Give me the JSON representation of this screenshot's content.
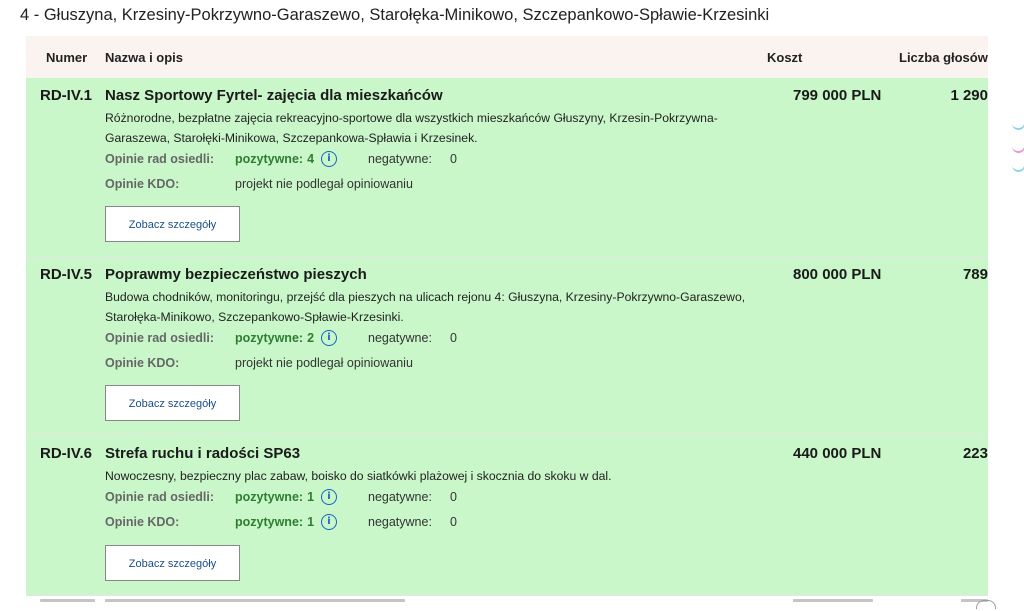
{
  "section": {
    "title": "4 - Głuszyna, Krzesiny-Pokrzywno-Garaszewo, Starołęka-Minikowo, Szczepankowo-Spławie-Krzesinki"
  },
  "table": {
    "headers": {
      "number": "Numer",
      "name": "Nazwa i opis",
      "cost": "Koszt",
      "votes": "Liczba głosów"
    },
    "labels": {
      "council_opinions": "Opinie rad osiedli:",
      "kdo_opinions": "Opinie KDO:",
      "positive": "pozytywne:",
      "negative": "negatywne:",
      "not_reviewed": "projekt nie podlegał opiniowaniu",
      "details_button": "Zobacz szczegóły"
    },
    "rows": [
      {
        "number": "RD-IV.1",
        "title": "Nasz Sportowy Fyrtel- zajęcia dla mieszkańców",
        "description": "Różnorodne, bezpłatne zajęcia rekreacyjno-sportowe dla wszystkich mieszkańców Głuszyny, Krzesin-Pokrzywna-Garaszewa, Starołęki-Minikowa, Szczepankowa-Spławia i Krzesinek.",
        "cost": "799 000 PLN",
        "votes": "1 290",
        "council_positive": "4",
        "council_negative": "0"
      },
      {
        "number": "RD-IV.5",
        "title": "Poprawmy bezpieczeństwo pieszych",
        "description": "Budowa chodników, monitoringu, przejść dla pieszych na ulicach rejonu 4: Głuszyna, Krzesiny-Pokrzywno-Garaszewo, Starołęka-Minikowo, Szczepankowo-Spławie-Krzesinki.",
        "cost": "800 000 PLN",
        "votes": "789",
        "council_positive": "2",
        "council_negative": "0"
      },
      {
        "number": "RD-IV.6",
        "title": "Strefa ruchu i radości SP63",
        "description": "Nowoczesny, bezpieczny plac zabaw, boisko do siatkówki plażowej i skocznia do skoku w dal.",
        "cost": "440 000 PLN",
        "votes": "223",
        "council_positive": "1",
        "council_negative": "0",
        "kdo_positive": "1",
        "kdo_negative": "0"
      }
    ]
  },
  "colors": {
    "row_bg": "#c9f7c9",
    "header_bg": "#fbf3f0",
    "positive": "#2e7d32",
    "link": "#1a4f8a",
    "info": "#1565c0"
  },
  "icons": {
    "info": "info-circle-icon"
  }
}
